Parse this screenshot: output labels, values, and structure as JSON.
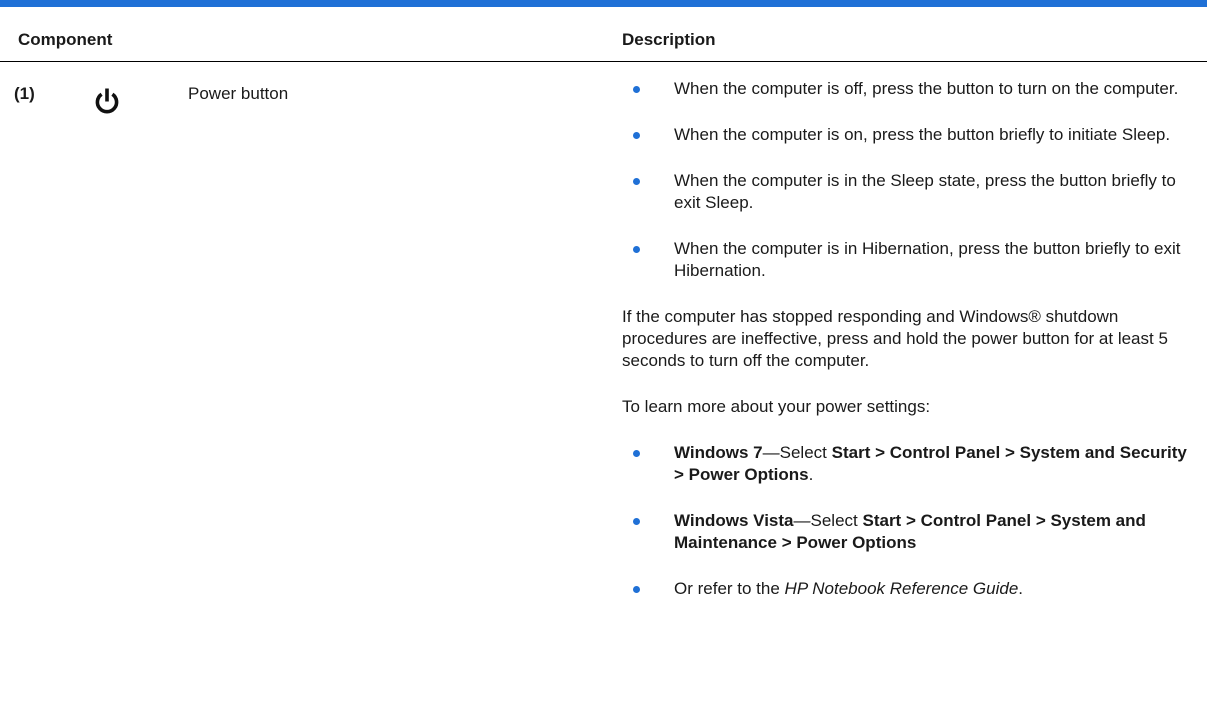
{
  "colors": {
    "accent_rule": "#1f70d6",
    "bullet": "#1f70d6",
    "text": "#1a1a1a"
  },
  "table": {
    "headers": {
      "component": "Component",
      "description": "Description"
    },
    "row": {
      "number": "(1)",
      "icon": "power-icon",
      "name": "Power button",
      "bullets_1": [
        "When the computer is off, press the button to turn on the computer.",
        "When the computer is on, press the button briefly to initiate Sleep.",
        "When the computer is in the Sleep state, press the button briefly to exit Sleep.",
        "When the computer is in Hibernation, press the button briefly to exit Hibernation."
      ],
      "para_1": "If the computer has stopped responding and Windows® shutdown procedures are ineffective, press and hold the power button for at least 5 seconds to turn off the computer.",
      "para_2": "To learn more about your power settings:",
      "win7": {
        "os": "Windows 7",
        "mid": "—Select ",
        "path": "Start > Control Panel > System and Security > Power Options",
        "end": "."
      },
      "vista": {
        "os": "Windows Vista",
        "mid": "—Select ",
        "path": "Start > Control Panel > System and Maintenance > Power Options"
      },
      "guide": {
        "pre": "Or refer to the ",
        "title": "HP Notebook Reference Guide",
        "end": "."
      }
    }
  }
}
